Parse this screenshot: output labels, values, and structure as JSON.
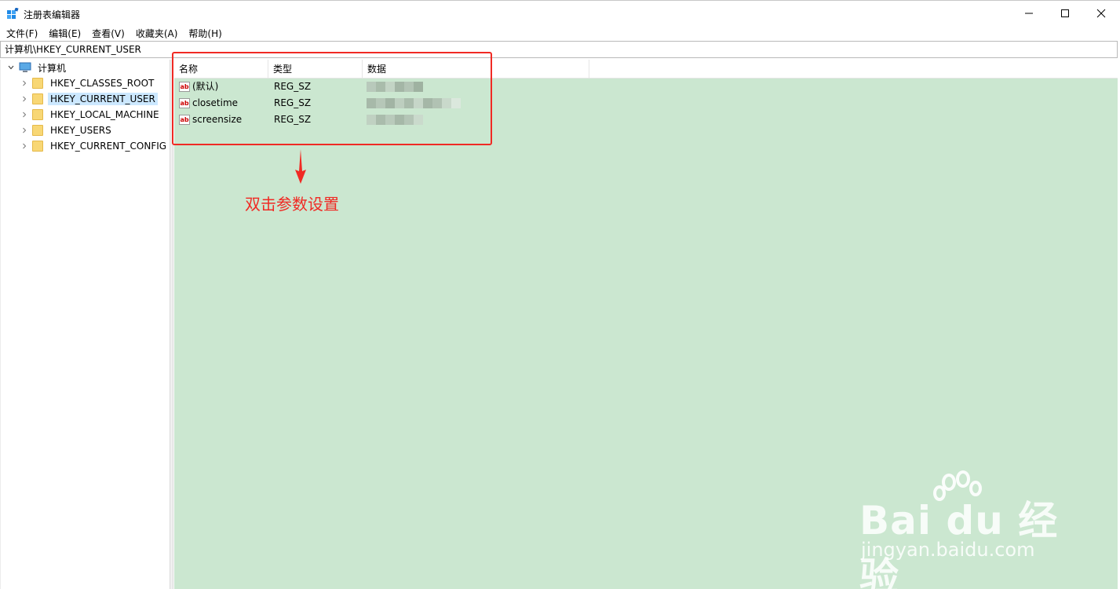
{
  "window": {
    "title": "注册表编辑器",
    "controls": {
      "minimize_icon": "minimize-icon",
      "maximize_icon": "maximize-icon",
      "close_icon": "close-icon"
    }
  },
  "menu": [
    {
      "label": "文件(F)"
    },
    {
      "label": "编辑(E)"
    },
    {
      "label": "查看(V)"
    },
    {
      "label": "收藏夹(A)"
    },
    {
      "label": "帮助(H)"
    }
  ],
  "address": {
    "path": "计算机\\HKEY_CURRENT_USER"
  },
  "tree": {
    "root": {
      "label": "计算机",
      "icon": "computer-icon",
      "expanded": true
    },
    "items": [
      {
        "label": "HKEY_CLASSES_ROOT",
        "selected": false
      },
      {
        "label": "HKEY_CURRENT_USER",
        "selected": true
      },
      {
        "label": "HKEY_LOCAL_MACHINE",
        "selected": false
      },
      {
        "label": "HKEY_USERS",
        "selected": false
      },
      {
        "label": "HKEY_CURRENT_CONFIG",
        "selected": false
      }
    ]
  },
  "list": {
    "columns": [
      "名称",
      "类型",
      "数据"
    ],
    "rows": [
      {
        "name": "(默认)",
        "type": "REG_SZ",
        "icon": "string-value-icon"
      },
      {
        "name": "closetime",
        "type": "REG_SZ",
        "icon": "string-value-icon"
      },
      {
        "name": "screensize",
        "type": "REG_SZ",
        "icon": "string-value-icon"
      }
    ]
  },
  "annotation": {
    "text": "双击参数设置",
    "color": "#f02a24"
  },
  "watermark": {
    "brand": "Bai du 经验",
    "url": "jingyan.baidu.com"
  },
  "colors": {
    "list_background": "#cbe7d0",
    "selection": "#cce8ff",
    "folder": "#f8d775"
  }
}
